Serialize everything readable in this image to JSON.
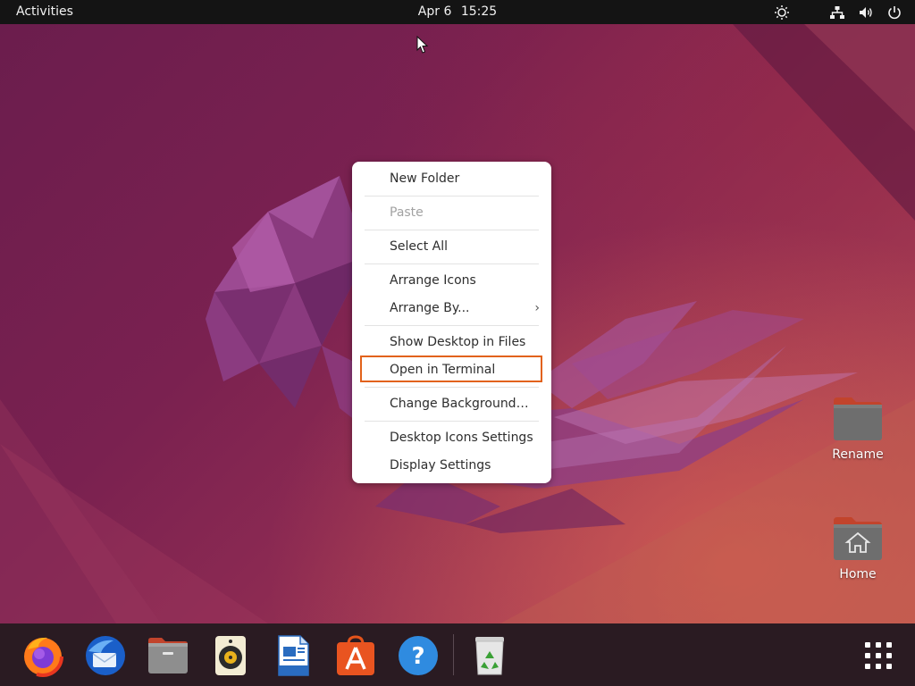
{
  "top_bar": {
    "activities_label": "Activities",
    "date": "Apr 6",
    "time": "15:25",
    "tray_icons": [
      "accessibility-icon",
      "network-icon",
      "volume-icon",
      "power-icon"
    ]
  },
  "context_menu": {
    "items": [
      {
        "label": "New Folder",
        "enabled": true
      },
      {
        "label": "Paste",
        "enabled": false
      },
      {
        "label": "Select All",
        "enabled": true
      },
      {
        "label": "Arrange Icons",
        "enabled": true
      },
      {
        "label": "Arrange By...",
        "enabled": true,
        "has_submenu": true
      },
      {
        "label": "Show Desktop in Files",
        "enabled": true
      },
      {
        "label": "Open in Terminal",
        "enabled": true,
        "highlighted": true
      },
      {
        "label": "Change Background…",
        "enabled": true
      },
      {
        "label": "Desktop Icons Settings",
        "enabled": true
      },
      {
        "label": "Display Settings",
        "enabled": true
      }
    ],
    "submenu_arrow": "›",
    "highlight_color": "#e2621b"
  },
  "desktop_icons": [
    {
      "label": "Rename",
      "icon": "folder-icon"
    },
    {
      "label": "Home",
      "icon": "home-folder-icon"
    }
  ],
  "dock": {
    "apps": [
      {
        "name": "Firefox",
        "icon": "firefox-icon"
      },
      {
        "name": "Thunderbird",
        "icon": "thunderbird-icon"
      },
      {
        "name": "Files",
        "icon": "files-icon"
      },
      {
        "name": "Rhythmbox",
        "icon": "rhythmbox-icon"
      },
      {
        "name": "LibreOffice Writer",
        "icon": "writer-icon"
      },
      {
        "name": "Ubuntu Software",
        "icon": "software-icon"
      },
      {
        "name": "Help",
        "icon": "help-icon"
      },
      {
        "name": "Trash",
        "icon": "trash-icon"
      },
      {
        "name": "Show Applications",
        "icon": "app-grid-icon"
      }
    ],
    "help_glyph": "?"
  },
  "colors": {
    "top_bar": "#141414",
    "dock": "#2a1b22",
    "wallpaper_primary": "#7a2150",
    "wallpaper_accent": "#b5504f"
  }
}
